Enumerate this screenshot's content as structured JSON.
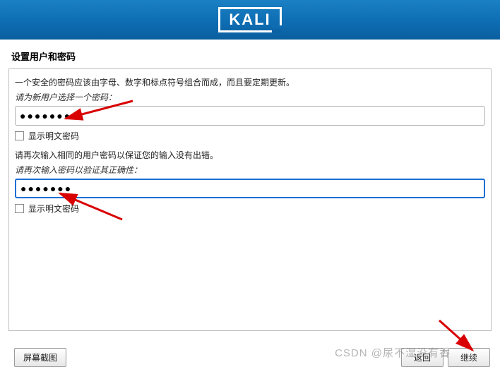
{
  "banner": {
    "logo": "KALI"
  },
  "title": "设置用户和密码",
  "panel": {
    "hint_top": "一个安全的密码应该由字母、数字和标点符号组合而成，而且要定期更新。",
    "label_password": "请为新用户选择一个密码：",
    "password_value": "●●●●●●●",
    "show_plain_1": "显示明文密码",
    "hint_confirm": "请再次输入相同的用户密码以保证您的输入没有出错。",
    "label_confirm": "请再次输入密码以验证其正确性：",
    "confirm_value": "●●●●●●●",
    "show_plain_2": "显示明文密码"
  },
  "footer": {
    "screenshot": "屏幕截图",
    "back": "返回",
    "continue": "继续"
  },
  "watermark": "CSDN @尿不湿没有香"
}
